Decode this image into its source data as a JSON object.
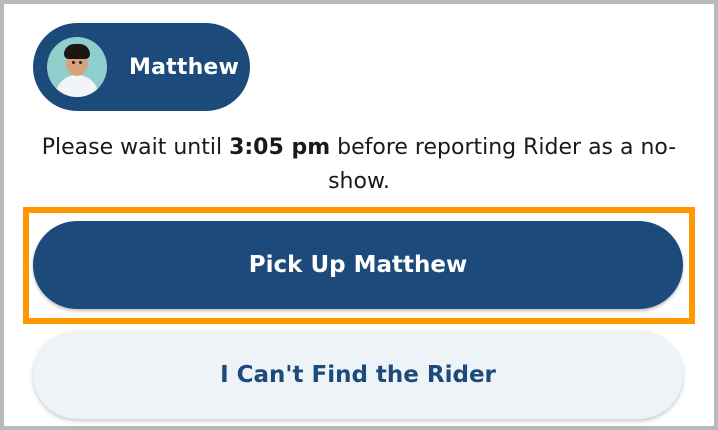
{
  "rider": {
    "name": "Matthew",
    "avatar_icon": "child-avatar-photo"
  },
  "message": {
    "prefix": "Please wait until ",
    "time": "3:05 pm",
    "suffix": " before reporting Rider as a no-show."
  },
  "actions": {
    "pickup_label": "Pick Up Matthew",
    "cant_find_label": "I Can't Find the Rider"
  },
  "colors": {
    "primary": "#1c4a7a",
    "secondary_bg": "#eef3f8",
    "highlight": "#ff9800"
  }
}
